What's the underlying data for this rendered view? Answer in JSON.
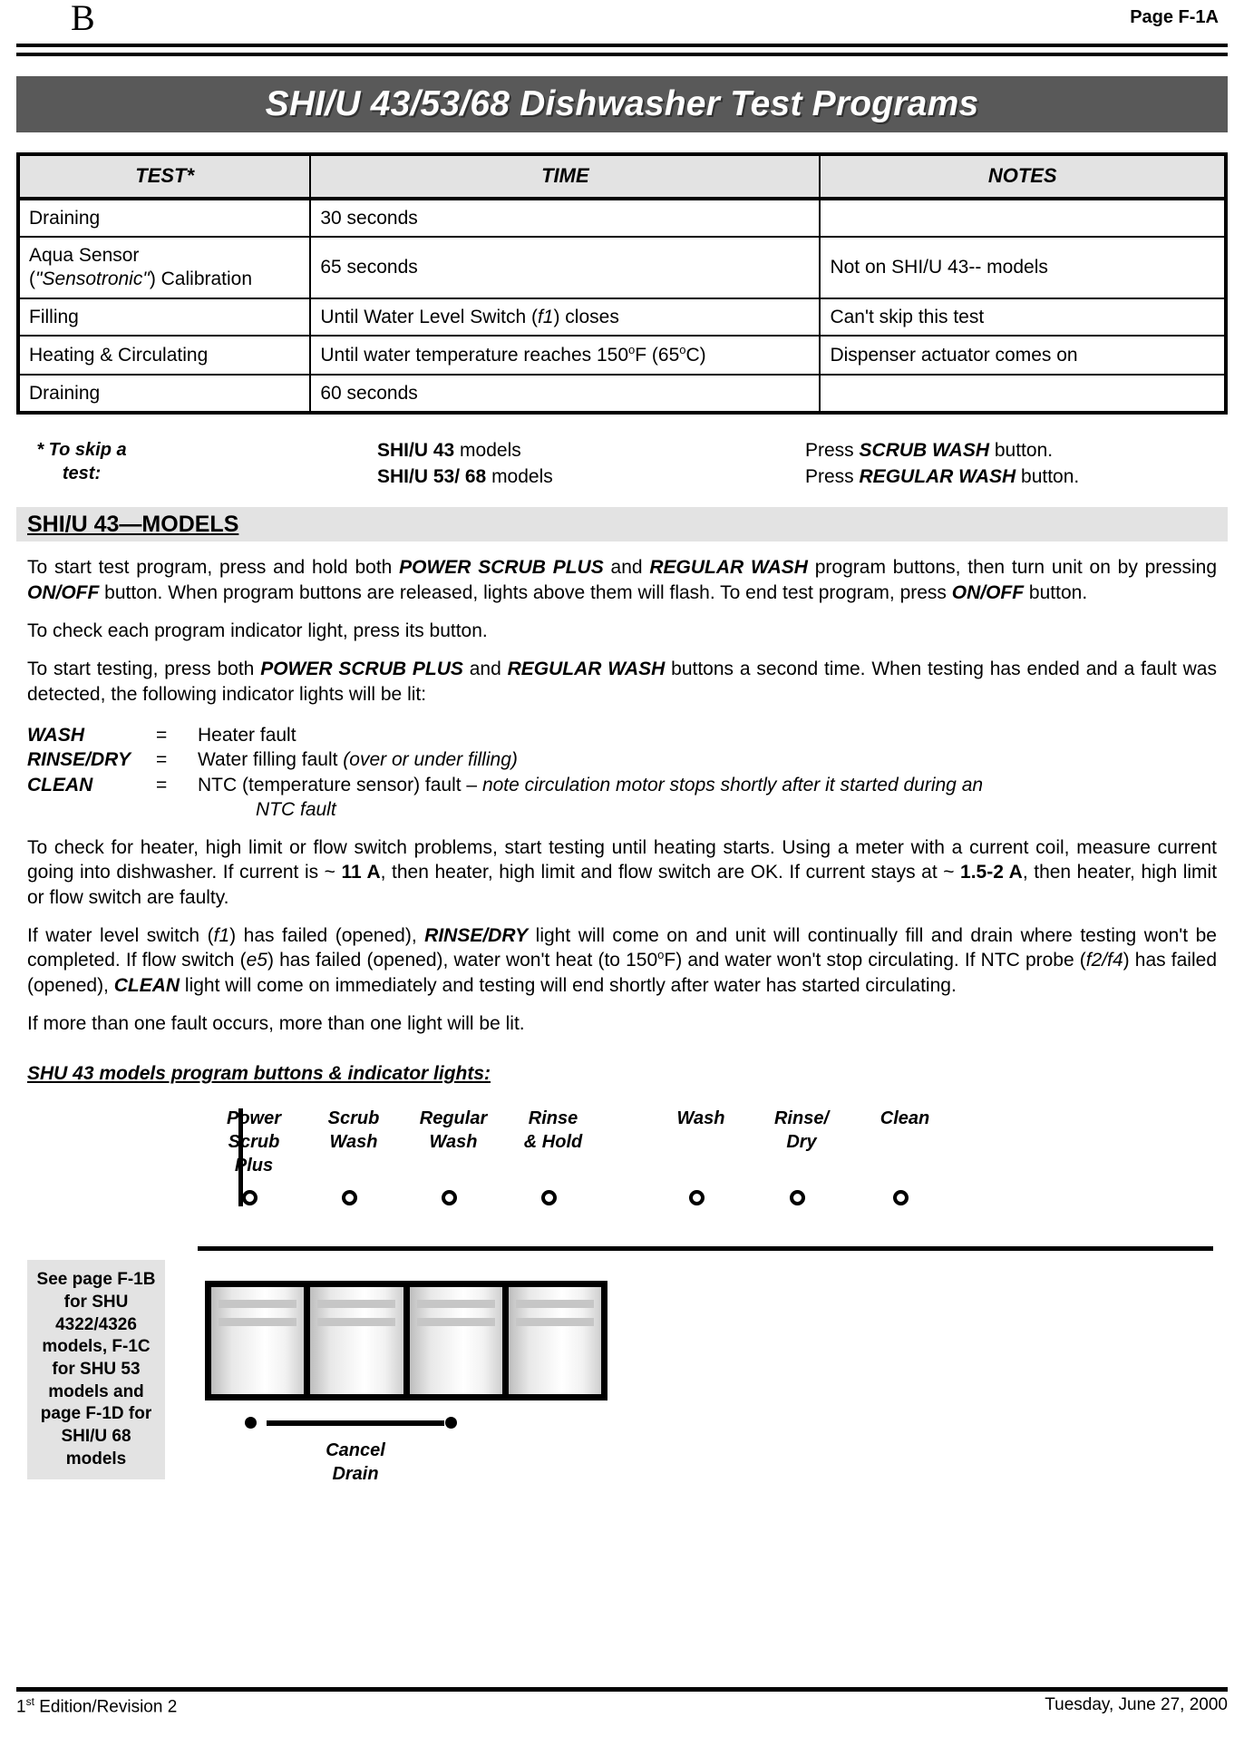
{
  "header": {
    "section_letter": "B",
    "page_label": "Page F-1A"
  },
  "title": "SHI/U 43/53/68 Dishwasher Test Programs",
  "table": {
    "columns": [
      "TEST*",
      "TIME",
      "NOTES"
    ],
    "rows": [
      {
        "test": "Draining",
        "test2": "",
        "time": "30 seconds",
        "notes": ""
      },
      {
        "test": "Aqua Sensor",
        "test2": "(\"Sensotronic\") Calibration",
        "time": "65 seconds",
        "notes": "Not on SHI/U 43-- models"
      },
      {
        "test": "Filling",
        "test2": "",
        "time_pre": "Until Water Level Switch (",
        "time_em": "f1",
        "time_post": ") closes",
        "notes": "Can't skip this test"
      },
      {
        "test": "Heating & Circulating",
        "test2": "",
        "time_pre": "Until water temperature reaches 150",
        "time_deg": "o",
        "time_mid": "F (65",
        "time_deg2": "o",
        "time_post": "C)",
        "notes": "Dispenser actuator comes on"
      },
      {
        "test": "Draining",
        "test2": "",
        "time": "60 seconds",
        "notes": ""
      }
    ]
  },
  "skip_note": {
    "label": "* To skip a test:",
    "rows": [
      {
        "model_bold": "SHI/U 43",
        "model_rest": " models",
        "action_pre": "Press ",
        "action_em": "SCRUB WASH",
        "action_post": " button."
      },
      {
        "model_bold": "SHI/U 53/ 68",
        "model_rest": "  models",
        "action_pre": "Press ",
        "action_em": "REGULAR WASH",
        "action_post": " button."
      }
    ]
  },
  "section_heading": "SHI/U 43—MODELS",
  "paragraphs": {
    "p1": {
      "a": "To start test program, press and hold both ",
      "b1": "POWER SCRUB PLUS",
      "b": " and ",
      "b2": "REGULAR WASH",
      "c": " program buttons, then turn unit on by pressing ",
      "b3": "ON/OFF",
      "d": " button.  When program buttons are released, lights above them will flash.  To end test program, press ",
      "b4": "ON/OFF",
      "e": " button."
    },
    "p2": "To check each program indicator light, press its button.",
    "p3": {
      "a": "To start testing, press both ",
      "b1": "POWER SCRUB PLUS",
      "b": " and ",
      "b2": "REGULAR WASH",
      "c": " buttons a second time.  When testing has ended and a fault was detected, the following indicator lights will be lit:"
    },
    "p4": {
      "a": "To check for heater, high limit or flow switch problems, start testing until heating starts.  Using a meter with a current coil, measure current going into dishwasher.  If current is ~ ",
      "b1": "11 A",
      "b": ", then heater, high limit and flow switch are OK.  If current stays at ~ ",
      "b2": "1.5-2 A",
      "c": ", then heater, high limit or flow switch are faulty."
    },
    "p5": {
      "a": "If water level switch (",
      "i1": "f1",
      "b": ") has failed (opened), ",
      "b1": "RINSE/DRY",
      "c": " light will come on and unit will continually fill and drain where testing won't be completed.  If flow switch (",
      "i2": "e5",
      "d": ") has failed (opened), water won't heat (to 150",
      "deg": "o",
      "e": "F) and water won't stop circulating.  If NTC probe (",
      "i3": "f2/f4",
      "f": ") has failed (opened), ",
      "b2": "CLEAN",
      "g": " light will come on immediately and testing will end shortly after water has started circulating."
    },
    "p6": "If more than one fault occurs, more than one light will be lit."
  },
  "faults": [
    {
      "name": "WASH",
      "eq": "=",
      "value": "Heater fault",
      "value_em": ""
    },
    {
      "name": "RINSE/DRY",
      "eq": "=",
      "value": "Water filling fault ",
      "value_em": "(over or under filling)"
    },
    {
      "name": "CLEAN",
      "eq": "=",
      "value": "NTC (temperature sensor) fault – ",
      "value_em": "note circulation motor stops shortly after it started during an",
      "cont_em": "NTC fault"
    }
  ],
  "diagram": {
    "heading": "SHU 43 models program buttons & indicator lights:",
    "labels": [
      {
        "lines": [
          "Power",
          "Scrub",
          "Plus"
        ]
      },
      {
        "lines": [
          "Scrub",
          "Wash"
        ]
      },
      {
        "lines": [
          "Regular",
          "Wash"
        ]
      },
      {
        "lines": [
          "Rinse",
          "& Hold"
        ]
      },
      {
        "lines": [
          "Wash"
        ]
      },
      {
        "lines": [
          "Rinse/",
          "Dry"
        ]
      },
      {
        "lines": [
          "Clean"
        ]
      }
    ],
    "led_count": 7,
    "cancel_drain": [
      "Cancel",
      "Drain"
    ],
    "sidebox": "See page F-1B for SHU 4322/4326 models, F-1C for SHU 53 models and page F-1D for SHI/U 68 models"
  },
  "footer": {
    "edition_num": "1",
    "edition_sup": "st",
    "edition_rest": " Edition/Revision 2",
    "date": "Tuesday, June 27, 2000"
  },
  "colors": {
    "title_band": "#595959",
    "band_light": "#e3e3e3",
    "rule": "#000000"
  }
}
